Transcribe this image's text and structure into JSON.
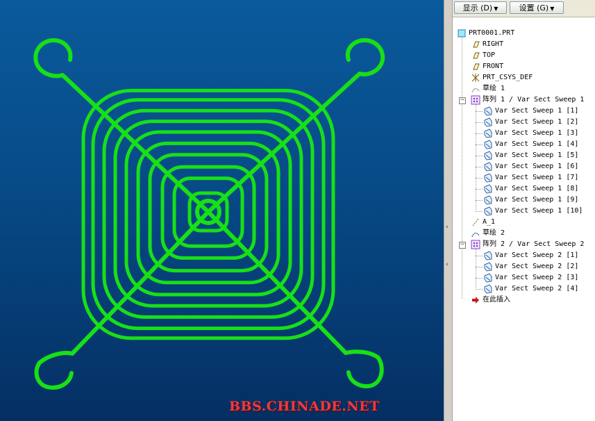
{
  "toolbar": {
    "display_label": "显示 (D)",
    "settings_label": "设置 (G)"
  },
  "tree": {
    "root": "PRT0001.PRT",
    "items": [
      "RIGHT",
      "TOP",
      "FRONT",
      "PRT_CSYS_DEF",
      "草绘 1"
    ],
    "pattern1": {
      "label": "阵列 1 / Var Sect Sweep 1",
      "children": [
        "Var Sect Sweep 1 [1]",
        "Var Sect Sweep 1 [2]",
        "Var Sect Sweep 1 [3]",
        "Var Sect Sweep 1 [4]",
        "Var Sect Sweep 1 [5]",
        "Var Sect Sweep 1 [6]",
        "Var Sect Sweep 1 [7]",
        "Var Sect Sweep 1 [8]",
        "Var Sect Sweep 1 [9]",
        "Var Sect Sweep 1 [10]"
      ]
    },
    "axis": "A_1",
    "sketch2": "草绘 2",
    "pattern2": {
      "label": "阵列 2 / Var Sect Sweep 2",
      "children": [
        "Var Sect Sweep 2 [1]",
        "Var Sect Sweep 2 [2]",
        "Var Sect Sweep 2 [3]",
        "Var Sect Sweep 2 [4]"
      ]
    },
    "insert_here": "在此插入"
  },
  "viewport": {
    "watermark": "BBS.CHINADE.NET",
    "model_color": "#19e619",
    "background_color": "#064a86"
  }
}
